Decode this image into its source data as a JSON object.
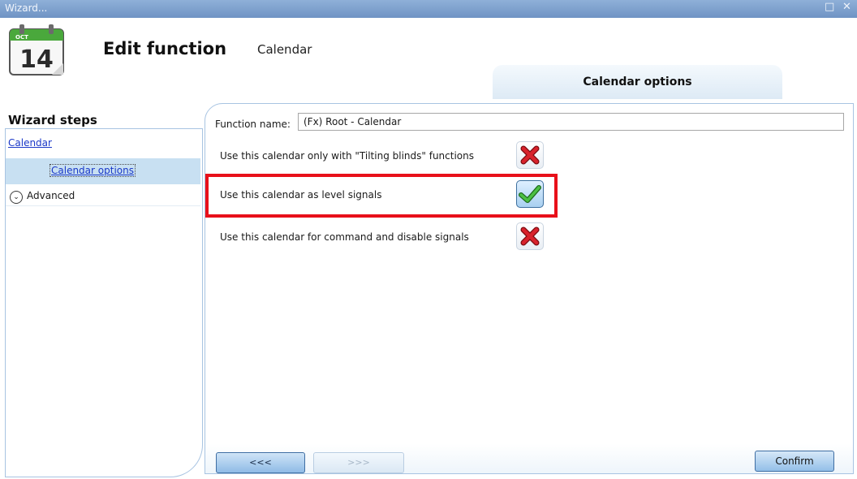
{
  "window": {
    "title": "Wizard...",
    "restore_glyph": "□",
    "close_glyph": "✕"
  },
  "header": {
    "icon": {
      "name": "calendar-icon",
      "month": "OCT",
      "day": "14"
    },
    "title": "Edit function",
    "subtitle": "Calendar"
  },
  "tab": {
    "label": "Calendar options"
  },
  "wizard": {
    "title": "Wizard steps",
    "steps": [
      {
        "label": "Calendar"
      },
      {
        "label": "Calendar options",
        "selected": true
      },
      {
        "label": "Advanced",
        "icon": "chevron-down-circle-icon"
      }
    ]
  },
  "form": {
    "function_name_label": "Function name:",
    "function_name_value": "(Fx) Root - Calendar",
    "options": [
      {
        "label": "Use this calendar only with \"Tilting blinds\" functions",
        "checked": false
      },
      {
        "label": "Use this calendar as level signals",
        "checked": true,
        "highlighted": true
      },
      {
        "label": "Use this calendar for command and disable signals",
        "checked": false
      }
    ]
  },
  "nav": {
    "prev_label": "<<<",
    "next_label": ">>>",
    "confirm_label": "Confirm"
  },
  "colors": {
    "titlebar": "#7fa2d0",
    "accent_blue": "#1a38c8",
    "highlight_red": "#e8101a",
    "check_green": "#3fa83a",
    "cross_red": "#d0202a"
  }
}
